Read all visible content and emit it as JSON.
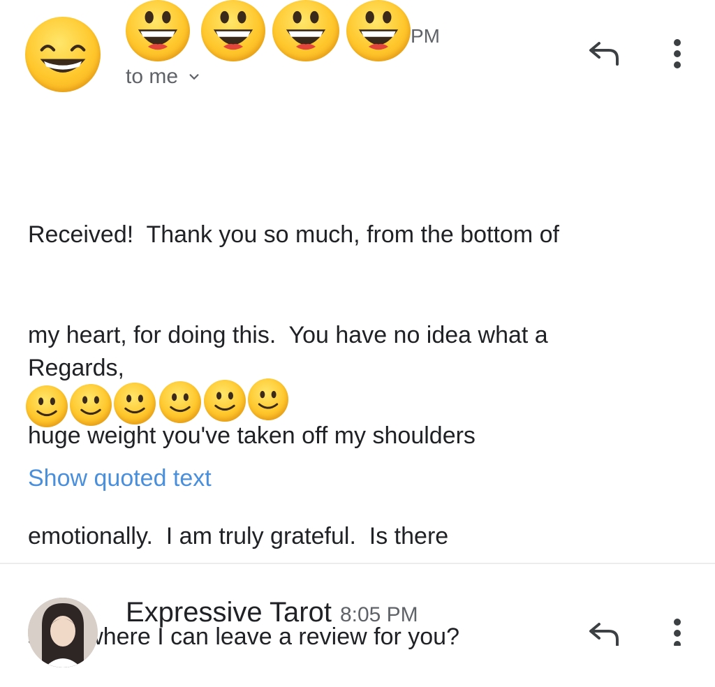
{
  "message1": {
    "time_fragment": "PM",
    "recipient_label": "to me",
    "body_lines": [
      "Received!  Thank you so much, from the bottom of",
      "my heart, for doing this.  You have no idea what a",
      "huge weight you've taken off my shoulders",
      "emotionally.  I am truly grateful.  Is there",
      "somewhere I can leave a review for you?"
    ],
    "signoff": "Regards,",
    "show_quoted_label": "Show quoted text"
  },
  "message2": {
    "sender": "Expressive Tarot",
    "time": "8:05 PM"
  },
  "icons": {
    "avatar1": "grinning-face-emoji",
    "redaction1": "grinning-face-with-big-eyes-emoji",
    "redaction2": "slightly-smiling-face-emoji",
    "reply": "reply-arrow-icon",
    "more": "more-vertical-icon",
    "chevron": "chevron-down-icon"
  },
  "colors": {
    "link": "#4a8fdc",
    "secondary_text": "#5f6368",
    "primary_text": "#202124",
    "emoji_yellow": "#ffc72c"
  }
}
